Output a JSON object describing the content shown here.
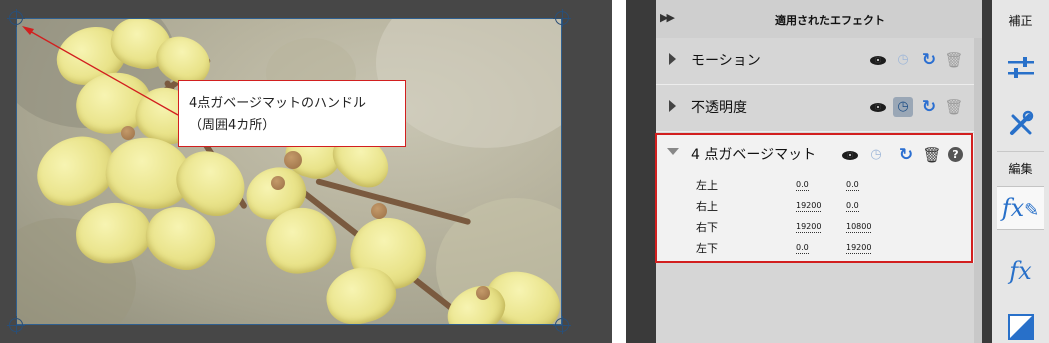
{
  "callout": {
    "line1": "4点ガベージマットのハンドル",
    "line2": "（周囲4カ所）"
  },
  "panel": {
    "title": "適用されたエフェクト",
    "collapse_icon": "double-chevron-right-icon",
    "timer_icon": "stopwatch-icon"
  },
  "effects": {
    "motion": "モーション",
    "opacity": "不透明度",
    "garbage": "4 点ガベージマット"
  },
  "params": [
    {
      "label": "左上",
      "x": "0.0",
      "y": "0.0"
    },
    {
      "label": "右上",
      "x": "19200",
      "y": "0.0"
    },
    {
      "label": "右下",
      "x": "19200",
      "y": "10800"
    },
    {
      "label": "左下",
      "x": "0.0",
      "y": "19200"
    }
  ],
  "toolbar": {
    "adjust_label": "補正",
    "edit_label": "編集",
    "fx_text": "fx"
  },
  "colors": {
    "highlight": "#d21f1f",
    "accent": "#2870c9",
    "handle": "#2a4f77"
  }
}
